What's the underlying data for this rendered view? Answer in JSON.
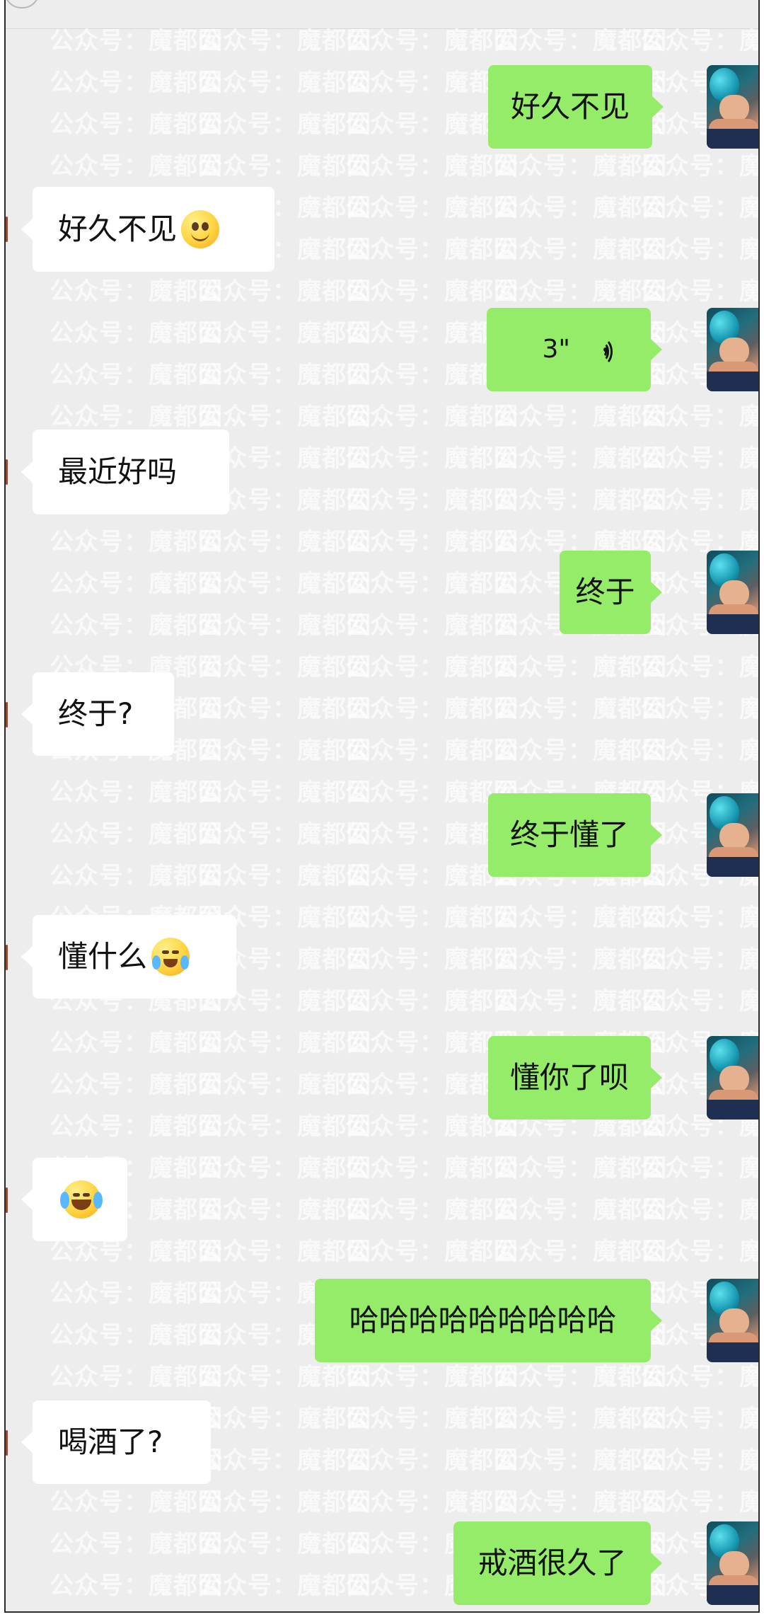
{
  "watermark": {
    "text": "公众号：魔都囡"
  },
  "messages": [
    {
      "side": "sent",
      "text": "好久不见"
    },
    {
      "side": "recv",
      "text": "好久不见",
      "emoji": "smile"
    },
    {
      "side": "sent",
      "type": "voice",
      "duration": "3\""
    },
    {
      "side": "recv",
      "text": "最近好吗"
    },
    {
      "side": "sent",
      "text": "终于"
    },
    {
      "side": "recv",
      "text": "终于?"
    },
    {
      "side": "sent",
      "text": "终于懂了"
    },
    {
      "side": "recv",
      "text": "懂什么",
      "emoji": "cry"
    },
    {
      "side": "sent",
      "text": "懂你了呗"
    },
    {
      "side": "recv",
      "text": "",
      "emoji": "laugh"
    },
    {
      "side": "sent",
      "text": "哈哈哈哈哈哈哈哈哈"
    },
    {
      "side": "recv",
      "text": "喝酒了?"
    },
    {
      "side": "sent",
      "text": "戒酒很久了"
    }
  ],
  "colors": {
    "background": "#ededed",
    "sent_bubble": "#95ec69",
    "received_bubble": "#ffffff",
    "text": "#111111"
  }
}
